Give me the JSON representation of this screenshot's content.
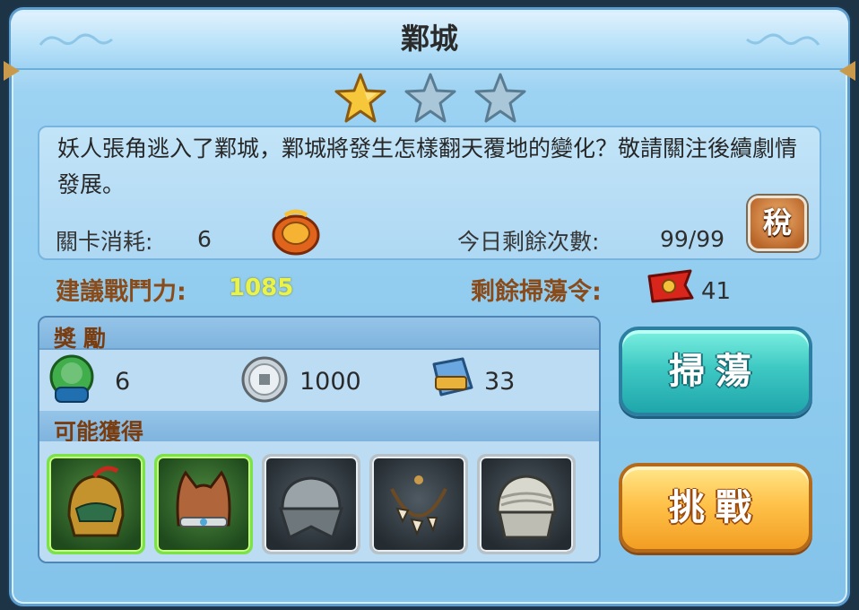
{
  "title": "鄴城",
  "stars": {
    "earned": 1,
    "total": 3
  },
  "description": "妖人張角逃入了鄴城，鄴城將發生怎樣翻天覆地的變化？敬請關注後續劇情發展。",
  "stage_cost": {
    "label": "關卡消耗:",
    "value": "6",
    "icon": "stamina-token-icon"
  },
  "remaining_today": {
    "label": "今日剩餘次數:",
    "value": "99/99"
  },
  "tax_button": {
    "label": "稅"
  },
  "recommended_power": {
    "label": "建議戰鬥力:",
    "value": "1085"
  },
  "sweep_tokens": {
    "label": "剩餘掃蕩令:",
    "value": "41",
    "icon": "sweep-flag-icon"
  },
  "rewards": {
    "title": "獎勵",
    "items": [
      {
        "icon": "lord-exp-icon",
        "value": "6"
      },
      {
        "icon": "coin-icon",
        "value": "1000"
      },
      {
        "icon": "exp-book-icon",
        "value": "33"
      }
    ]
  },
  "drops": {
    "title": "可能獲得",
    "items": [
      {
        "icon": "helmet-icon",
        "rarity": "green"
      },
      {
        "icon": "cat-hood-icon",
        "rarity": "green"
      },
      {
        "icon": "cloth-cap-icon",
        "rarity": "gray"
      },
      {
        "icon": "tooth-necklace-icon",
        "rarity": "gray"
      },
      {
        "icon": "bandana-icon",
        "rarity": "gray"
      }
    ]
  },
  "buttons": {
    "sweep": "掃蕩",
    "challenge": "挑戰"
  },
  "colors": {
    "power_value": "#eaf34a",
    "label_brown": "#8a4b1a",
    "frame_blue": "#8ecbee"
  }
}
